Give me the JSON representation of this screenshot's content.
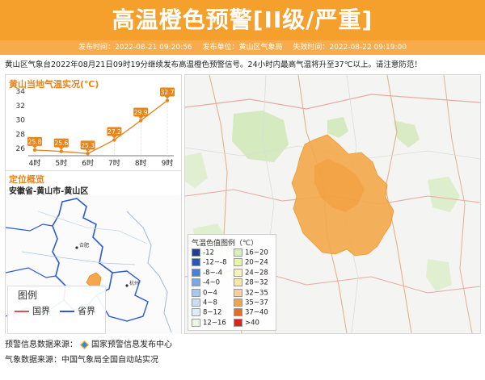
{
  "header": {
    "title": "高温橙色预警[II级/严重]",
    "publish_time": "发布时间：2022-08-21 09:20:56",
    "publisher": "发布单位：黄山区气象局",
    "expire_time": "失效时间：2022-08-22 09:19:00"
  },
  "description": "黄山区气象台2022年08月21日09时19分继续发布高温橙色预警信号。24小时内最高气温将升至37℃以上。请注意防范！",
  "temp_panel": {
    "title": "黄山当地气温实况(℃)"
  },
  "chart_data": {
    "type": "line",
    "title": "黄山当地气温实况(℃)",
    "categories": [
      "4时",
      "5时",
      "6时",
      "7时",
      "8时",
      "9时"
    ],
    "values": [
      25.8,
      25.6,
      25.3,
      27.2,
      29.9,
      32.7
    ],
    "value_labels": [
      "25.8",
      "25.6",
      "25.3",
      "27.2",
      "29.9",
      "32.7"
    ],
    "yticks": [
      "34",
      "32",
      "30",
      "28",
      "26"
    ],
    "ylim": [
      25,
      34
    ],
    "grid": false,
    "color": "#e8841a"
  },
  "location": {
    "title": "定位概览",
    "name": "安徽省-黄山市-黄山区",
    "labels": {
      "hefei": "合肥",
      "hangzhou": "杭州"
    }
  },
  "legend": {
    "title": "图例",
    "country": "国界",
    "province": "省界"
  },
  "scale": {
    "title": "气温色值图例（℃）",
    "items": [
      {
        "label": "-12",
        "color": "#1f3f8f"
      },
      {
        "label": "16~20",
        "color": "#d9f2b8"
      },
      {
        "label": "-12~-8",
        "color": "#2a59b5"
      },
      {
        "label": "20~24",
        "color": "#e9f5a6"
      },
      {
        "label": "-8~-4",
        "color": "#4a7fd6"
      },
      {
        "label": "24~28",
        "color": "#f7f3b8"
      },
      {
        "label": "-4~0",
        "color": "#79a6ea"
      },
      {
        "label": "28~32",
        "color": "#f6e7a2"
      },
      {
        "label": "0~4",
        "color": "#a7c8f0"
      },
      {
        "label": "32~35",
        "color": "#f8cf9a"
      },
      {
        "label": "4~8",
        "color": "#c8def5"
      },
      {
        "label": "35~37",
        "color": "#f5a24a"
      },
      {
        "label": "8~12",
        "color": "#dcecf8"
      },
      {
        "label": "37~40",
        "color": "#ea6a1e"
      },
      {
        "label": "12~16",
        "color": "#eef6e6"
      },
      {
        "label": ">40",
        "color": "#d9261c"
      }
    ]
  },
  "sources": {
    "warning": "预警信息数据来源：",
    "warning_org": "国家预警信息发布中心",
    "weather": "气象数据来源：中国气象局全国自动站实况"
  },
  "colors": {
    "banner": "#f5a02d",
    "accent": "#e8841a",
    "warning_area": "#f5a84a"
  }
}
